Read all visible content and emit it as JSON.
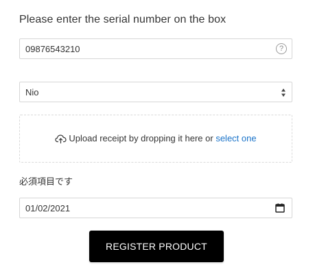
{
  "form": {
    "prompt": "Please enter the serial number on the box",
    "serial_value": "09876543210",
    "help_glyph": "?",
    "brand_selected": "Nio",
    "upload": {
      "text": "Upload receipt by dropping it here or",
      "link": "select one",
      "icon": "cloud-upload-icon"
    },
    "required_label": "必須項目です",
    "date_value": "01/02/2021",
    "submit_label": "REGISTER PRODUCT"
  },
  "colors": {
    "link": "#1a73c9",
    "button_bg": "#000000",
    "button_text": "#ffffff",
    "border": "#d6d6d6"
  }
}
